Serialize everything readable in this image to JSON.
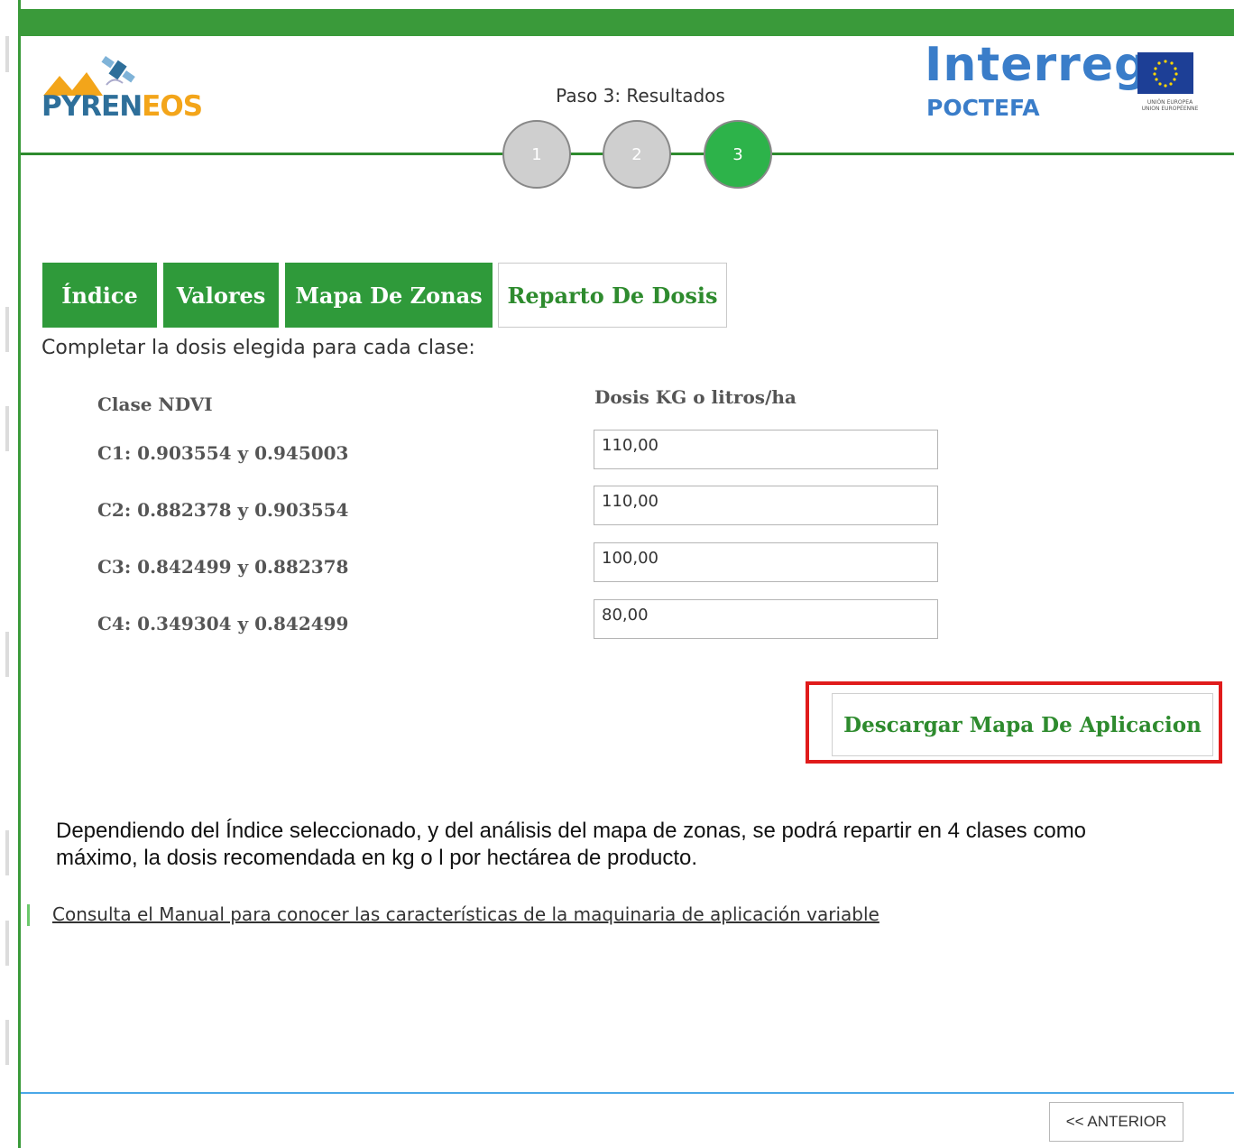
{
  "header": {
    "logo_left": "PYRENEOS",
    "logo_right": {
      "title": "Interreg",
      "subtitle": "POCTEFA",
      "flag_caption": "UNIÓN EUROPEA · UNION EUROPÉENNE"
    },
    "step_title": "Paso 3: Resultados",
    "steps": [
      "1",
      "2",
      "3"
    ],
    "active_step": 3,
    "colors": {
      "brand_green": "#3a9a3a",
      "active_step": "#2db34a",
      "inactive_step": "#cfcfcf"
    }
  },
  "tabs": [
    {
      "label": "Índice",
      "state": "inactive"
    },
    {
      "label": "Valores",
      "state": "inactive"
    },
    {
      "label": "Mapa De Zonas",
      "state": "inactive"
    },
    {
      "label": "Reparto De Dosis",
      "state": "active"
    }
  ],
  "form": {
    "instructions": "Completar la dosis elegida para cada clase:",
    "column_class": "Clase NDVI",
    "column_dose": "Dosis KG o litros/ha",
    "rows": [
      {
        "label": "C1: 0.903554 y 0.945003",
        "value": "110,00"
      },
      {
        "label": "C2: 0.882378 y 0.903554",
        "value": "110,00"
      },
      {
        "label": "C3: 0.842499 y 0.882378",
        "value": "100,00"
      },
      {
        "label": "C4: 0.349304 y 0.842499",
        "value": "80,00"
      }
    ]
  },
  "actions": {
    "download_label": "Descargar Mapa De Aplicacion",
    "highlight_color": "#e01b1b"
  },
  "description": {
    "line1": "Dependiendo del Índice seleccionado, y del análisis del mapa de zonas, se podrá repartir en 4 clases como",
    "line2": "máximo, la dosis recomendada en kg o l por hectárea de producto."
  },
  "manual_link": "Consulta el Manual para conocer las características de la maquinaria de aplicación variable",
  "footer": {
    "prev_label": "<< ANTERIOR"
  }
}
